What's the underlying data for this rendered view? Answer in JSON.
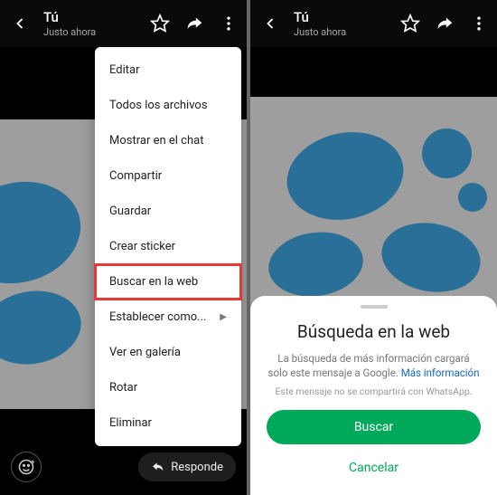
{
  "header": {
    "name": "Tú",
    "sub": "Justo ahora"
  },
  "menu": {
    "items": [
      {
        "label": "Editar",
        "arrow": false
      },
      {
        "label": "Todos los archivos",
        "arrow": false
      },
      {
        "label": "Mostrar en el chat",
        "arrow": false
      },
      {
        "label": "Compartir",
        "arrow": false
      },
      {
        "label": "Guardar",
        "arrow": false
      },
      {
        "label": "Crear sticker",
        "arrow": false
      },
      {
        "label": "Buscar en la web",
        "arrow": false,
        "highlight": true
      },
      {
        "label": "Establecer como...",
        "arrow": true
      },
      {
        "label": "Ver en galería",
        "arrow": false
      },
      {
        "label": "Rotar",
        "arrow": false
      },
      {
        "label": "Eliminar",
        "arrow": false
      }
    ]
  },
  "bottom": {
    "reply": "Responde"
  },
  "sheet": {
    "title": "Búsqueda en la web",
    "desc": "La búsqueda de más información cargará solo este mensaje a Google. ",
    "link": "Más información",
    "note": "Este mensaje no se compartirá con WhatsApp.",
    "primary": "Buscar",
    "secondary": "Cancelar"
  }
}
